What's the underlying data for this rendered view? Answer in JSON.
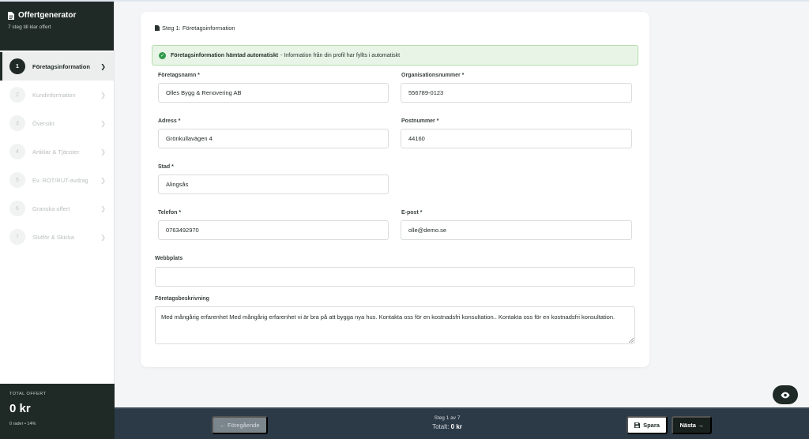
{
  "sidebar": {
    "title": "Offertgenerator",
    "subtitle": "7 steg till klar offert",
    "steps": [
      {
        "num": "1",
        "label": "Företagsinformation",
        "active": true
      },
      {
        "num": "2",
        "label": "Kundinformation"
      },
      {
        "num": "3",
        "label": "Översikt"
      },
      {
        "num": "4",
        "label": "Artiklar & Tjänster"
      },
      {
        "num": "5",
        "label": "Ev. ROT/RUT-avdrag"
      },
      {
        "num": "6",
        "label": "Granska offert"
      },
      {
        "num": "7",
        "label": "Slutför & Skicka"
      }
    ],
    "total_label": "TOTAL OFFERT",
    "total_value": "0 kr",
    "total_meta": "0 rader • 14%"
  },
  "main": {
    "step_heading": "Steg 1: Företagsinformation",
    "alert": {
      "title": "Företagsinformation hämtad automatiskt",
      "text": "- Information från din profil har fyllts i automatiskt"
    },
    "fields": {
      "company_name": {
        "label": "Företagsnamn *",
        "value": "Olles Bygg & Renovering AB"
      },
      "org_number": {
        "label": "Organisationsnummer *",
        "value": "556789-0123"
      },
      "address": {
        "label": "Adress *",
        "value": "Grönkullavägen 4"
      },
      "postal_code": {
        "label": "Postnummer *",
        "value": "44160"
      },
      "city": {
        "label": "Stad *",
        "value": "Alingsås"
      },
      "phone": {
        "label": "Telefon *",
        "value": "0763492970"
      },
      "email": {
        "label": "E-post *",
        "value": "olle@demo.se"
      },
      "website": {
        "label": "Webbplats",
        "value": ""
      },
      "description": {
        "label": "Företagsbeskrivning",
        "value": "Med mångårig erfarenhet Med mångårig erfarenhet vi är bra på att bygga nya hus. Kontakta oss för en kostnadsfri konsultation.. Kontakta oss för en kostnadsfri konsultation."
      }
    }
  },
  "footer": {
    "prev_label": "← Föregående",
    "step_text": "Steg 1 av 7",
    "total_prefix": "Totalt:",
    "total_value": "0 kr",
    "save_label": "Spara",
    "next_label": "Nästa →"
  },
  "icons": {
    "doc": "document-icon",
    "check": "check-circle-icon",
    "eye": "eye-icon",
    "save": "floppy-icon"
  },
  "colors": {
    "primary": "#1f2a27",
    "success_bg": "#e8f5e6",
    "success": "#2f9a4b",
    "footer_bg": "#2c3a47"
  }
}
